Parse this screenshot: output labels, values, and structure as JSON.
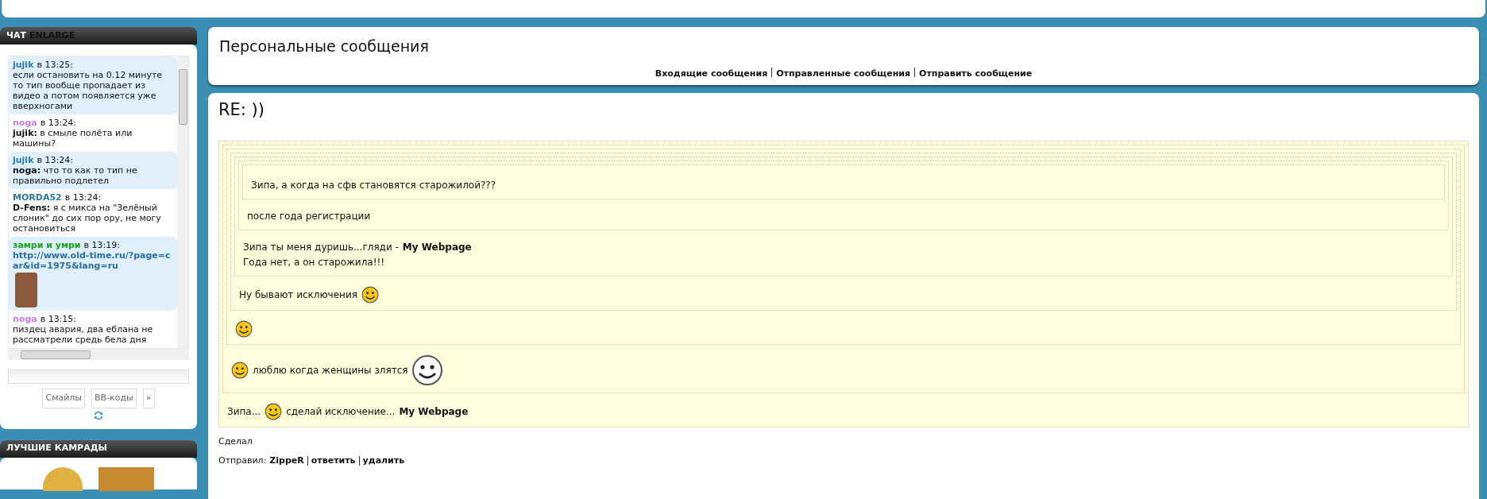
{
  "chat": {
    "title": "ЧАТ",
    "title_extra": "ENLARGE",
    "messages": [
      {
        "author": "jujik",
        "color": "#2a7aa8",
        "time": "в 13:25:",
        "highlighted": true,
        "kind": "text",
        "text": "если остановить на 0.12 минуте то тип вообще пропадает из видео а потом появляется уже вверхногами"
      },
      {
        "author": "noga",
        "color": "#c77ee0",
        "time": "в 13:24:",
        "highlighted": false,
        "kind": "text",
        "text": "**jujik:** в смыле полёта или машины?"
      },
      {
        "author": "jujik",
        "color": "#2a7aa8",
        "time": "в 13:24:",
        "highlighted": true,
        "kind": "text",
        "text": "**noga:** что то как то тип не правильно подлетел"
      },
      {
        "author": "MORDA52",
        "color": "#2a7aa8",
        "time": "в 13:24:",
        "highlighted": false,
        "kind": "text",
        "text": "**D-Fens:** я с микса на \"Зелёный слоник\" до сих пор ору, не могу остановиться"
      },
      {
        "author": "замри и умри",
        "color": "#1aa01a",
        "time": "в 13:19:",
        "highlighted": true,
        "kind": "link",
        "text": "http://www.old-time.ru/?page=car&id=1975&lang=ru"
      },
      {
        "author": "noga",
        "color": "#c77ee0",
        "time": "в 13:15:",
        "highlighted": false,
        "kind": "text",
        "text": "пиздец авария, два еблана не рассматрели средь бела дня"
      }
    ],
    "buttons": [
      "Смайлы",
      "BB-коды",
      "»"
    ]
  },
  "best": {
    "title": "ЛУЧШИЕ КАМРАДЫ"
  },
  "header": {
    "title": "Персональные сообщения",
    "links": [
      "Входящие сообщения",
      "Отправленные сообщения",
      "Отправить сообщение"
    ]
  },
  "message": {
    "subject": "RE: ))",
    "quote": {
      "lines": [
        [
          {
            "kind": "text",
            "text": "Зипа..."
          },
          {
            "kind": "emoji"
          },
          {
            "kind": "text",
            "text": "сделай исключение..."
          },
          {
            "kind": "link",
            "text": "My Webpage"
          }
        ]
      ],
      "quote": {
        "lines": [
          [
            {
              "kind": "emoji"
            },
            {
              "kind": "text",
              "text": "люблю когда женщины злятся"
            },
            {
              "kind": "bigemoji"
            }
          ]
        ],
        "quote": {
          "lines": [
            [
              {
                "kind": "emoji"
              }
            ]
          ],
          "quote": {
            "lines": [
              [
                {
                  "kind": "text",
                  "text": "Ну бывают исключения"
                },
                {
                  "kind": "emoji"
                }
              ]
            ],
            "quote": {
              "lines": [
                [
                  {
                    "kind": "text",
                    "text": "Зипа ты меня дуришь...гляди -"
                  },
                  {
                    "kind": "link",
                    "text": "My Webpage"
                  }
                ],
                [
                  {
                    "kind": "text",
                    "text": "Года нет, а он старожила!!!"
                  }
                ]
              ],
              "quote": {
                "lines": [
                  [
                    {
                      "kind": "text",
                      "text": "после года регистрации"
                    }
                  ]
                ],
                "quote": {
                  "lines": [
                    [
                      {
                        "kind": "text",
                        "text": "Зипа, а когда на сфв становятся старожилой???"
                      }
                    ]
                  ]
                }
              }
            }
          }
        }
      }
    },
    "reply": "Сделал",
    "sender_label": "Отправил:",
    "sender": "ZippeR",
    "actions": [
      "ответить",
      "удалить"
    ]
  }
}
